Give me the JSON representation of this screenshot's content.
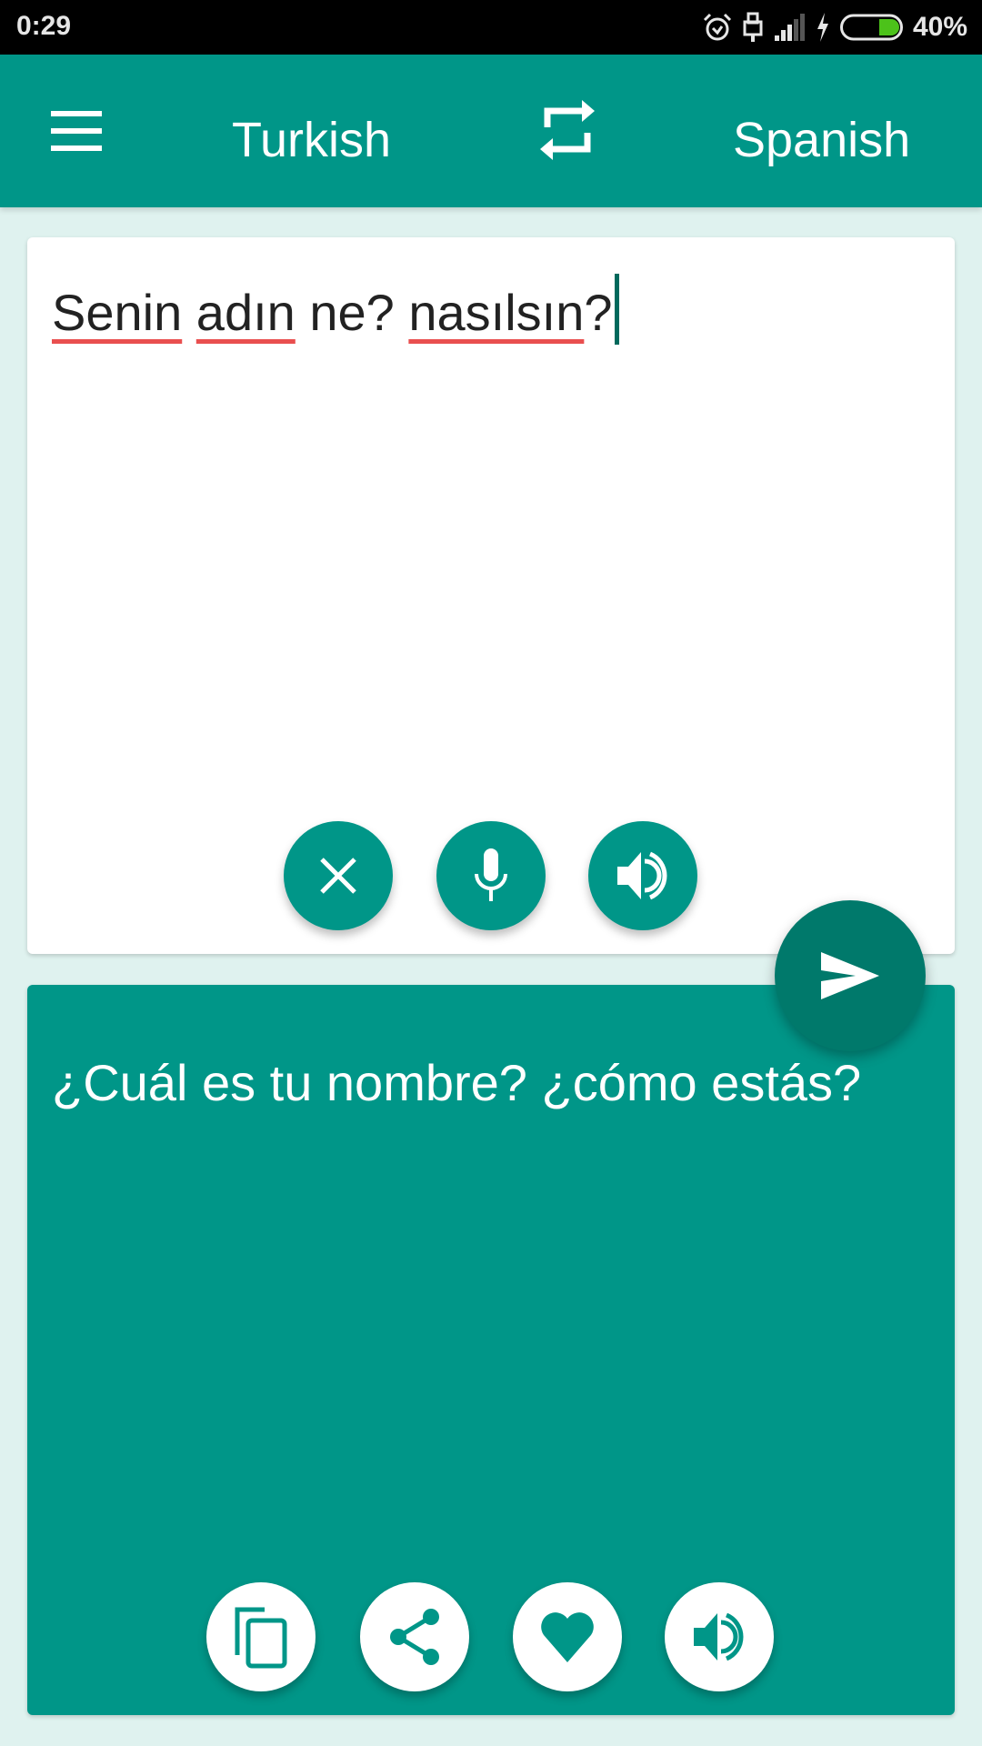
{
  "status_bar": {
    "time": "0:29",
    "battery_percent": "40%",
    "battery_level": 0.4,
    "icons": [
      "alarm-icon",
      "usb-icon",
      "signal-icon",
      "charging-icon",
      "battery-icon"
    ]
  },
  "app_bar": {
    "menu_icon": "hamburger-menu-icon",
    "source_language": "Turkish",
    "swap_icon": "swap-languages-icon",
    "target_language": "Spanish"
  },
  "input": {
    "words": [
      {
        "text": "Senin",
        "misspelled": true
      },
      {
        "text": " ",
        "misspelled": false
      },
      {
        "text": "adın",
        "misspelled": true
      },
      {
        "text": " ne? ",
        "misspelled": false
      },
      {
        "text": "nasılsın",
        "misspelled": true
      },
      {
        "text": "?",
        "misspelled": false
      }
    ],
    "buttons": [
      {
        "name": "clear",
        "icon": "close-icon"
      },
      {
        "name": "microphone",
        "icon": "microphone-icon"
      },
      {
        "name": "speak",
        "icon": "speaker-icon"
      }
    ]
  },
  "translate_button": {
    "icon": "send-icon"
  },
  "output": {
    "text": "¿Cuál es tu nombre? ¿cómo estás?",
    "buttons": [
      {
        "name": "copy",
        "icon": "copy-icon"
      },
      {
        "name": "share",
        "icon": "share-icon"
      },
      {
        "name": "favorite",
        "icon": "heart-icon"
      },
      {
        "name": "speak",
        "icon": "speaker-icon"
      }
    ]
  },
  "colors": {
    "primary": "#009688",
    "primary_dark": "#00796B",
    "background": "#DFF2EF",
    "spellcheck_underline": "#E94F4F",
    "battery_fill": "#4CC21A"
  }
}
